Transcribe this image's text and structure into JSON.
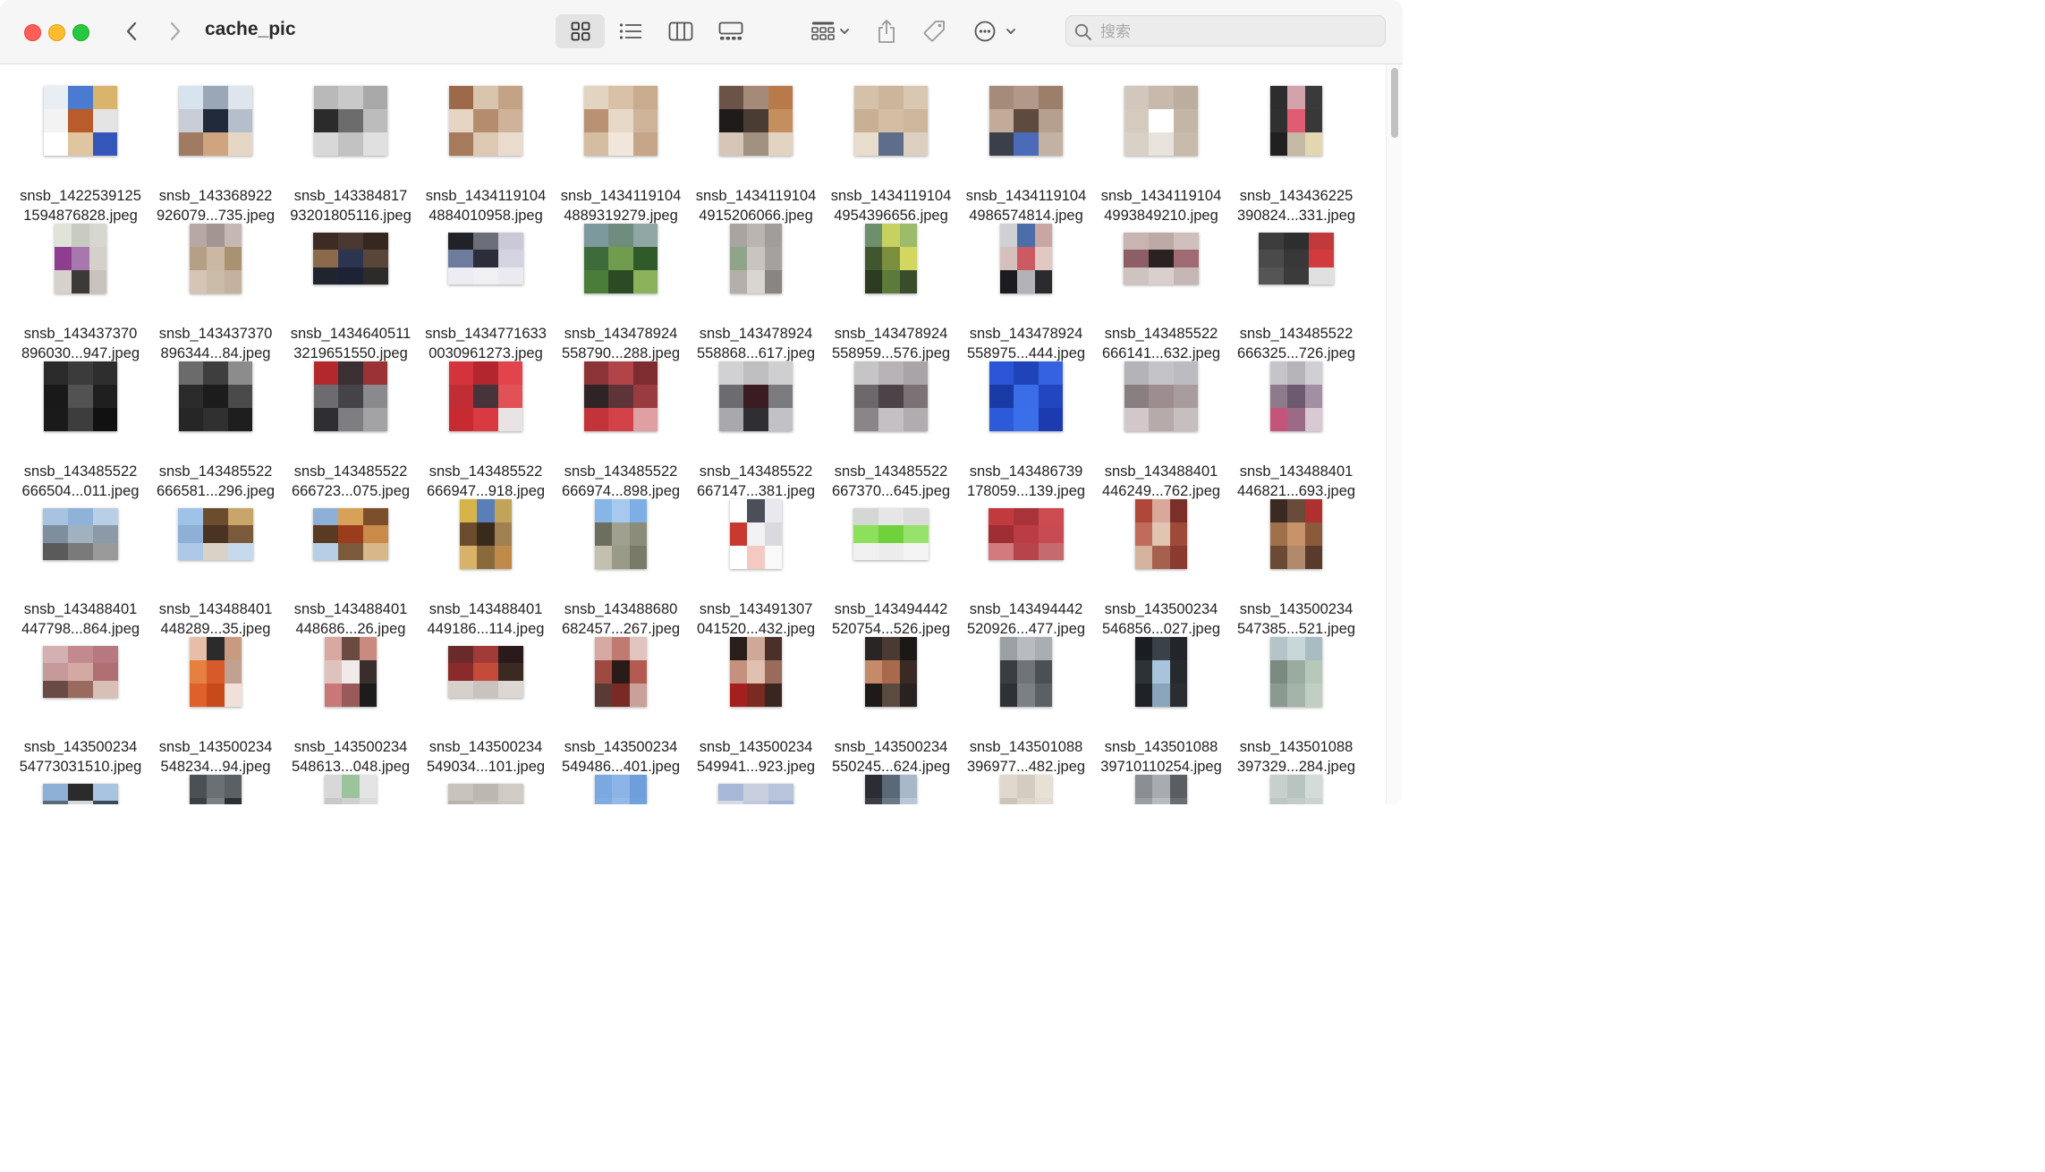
{
  "window": {
    "title": "cache_pic"
  },
  "toolbar": {
    "view_icons": "icon-view-grid-icon",
    "view_list": "list-view-icon",
    "view_columns": "column-view-icon",
    "view_gallery": "gallery-view-icon",
    "group": "group-by-icon",
    "share": "share-icon",
    "tags": "tag-icon",
    "more": "more-actions-icon"
  },
  "search": {
    "placeholder": "搜索",
    "value": ""
  },
  "files": [
    {
      "l1": "snsb_1422539125",
      "l2": "1594876828.jpeg",
      "c": [
        "#e9eef5",
        "#4a7bd0",
        "#d9b46a",
        "#f3f3f3",
        "#b95b2a",
        "#e4e4e4",
        "#ffffff",
        "#e0c6a0",
        "#3456b8"
      ],
      "shape": "sq"
    },
    {
      "l1": "snsb_143368922",
      "l2": "926079...735.jpeg",
      "c": [
        "#d7e3ef",
        "#9aa7b6",
        "#dfe5ec",
        "#c7ccd6",
        "#202a3b",
        "#b5bfcb",
        "#a07b62",
        "#d0a47f",
        "#e6d7c5"
      ],
      "shape": "sq"
    },
    {
      "l1": "snsb_143384817",
      "l2": "93201805116.jpeg",
      "c": [
        "#b9b9b9",
        "#c9c9c9",
        "#a9a9a9",
        "#2b2b2b",
        "#6c6c6c",
        "#bcbcbc",
        "#d8d8d8",
        "#c2c2c2",
        "#e0e0e0"
      ],
      "shape": "sq"
    },
    {
      "l1": "snsb_1434119104",
      "l2": "4884010958.jpeg",
      "c": [
        "#9c6a4b",
        "#d9c4ad",
        "#c4a285",
        "#e5d5c2",
        "#b58d6d",
        "#ceb39a",
        "#a57b5c",
        "#dcc8b3",
        "#e9dccd"
      ],
      "shape": "sq"
    },
    {
      "l1": "snsb_1434119104",
      "l2": "4889319279.jpeg",
      "c": [
        "#e3d4c1",
        "#d8c1a6",
        "#c9ab8e",
        "#b89273",
        "#e7d8c7",
        "#cfb49a",
        "#d5bda1",
        "#f0e6da",
        "#c6a688"
      ],
      "shape": "sq"
    },
    {
      "l1": "snsb_1434119104",
      "l2": "4915206066.jpeg",
      "c": [
        "#6b5447",
        "#a58a79",
        "#b97a4a",
        "#1f1b1a",
        "#4a3b33",
        "#c58e5f",
        "#d7c5b7",
        "#a19181",
        "#e2d3c2"
      ],
      "shape": "sq"
    },
    {
      "l1": "snsb_1434119104",
      "l2": "4954396656.jpeg",
      "c": [
        "#d4c1a9",
        "#ccb59b",
        "#d9c7b1",
        "#c9b094",
        "#d3bea4",
        "#cdb69c",
        "#e8dccd",
        "#5d6d8a",
        "#ddd0c0"
      ],
      "shape": "sq"
    },
    {
      "l1": "snsb_1434119104",
      "l2": "4986574814.jpeg",
      "c": [
        "#a58b79",
        "#b19888",
        "#9c7f6b",
        "#c2ab99",
        "#5e4a3e",
        "#b5a090",
        "#3b3f4c",
        "#4b6ab7",
        "#c3b2a3"
      ],
      "shape": "sq"
    },
    {
      "l1": "snsb_1434119104",
      "l2": "4993849210.jpeg",
      "c": [
        "#d2c7bd",
        "#c7baac",
        "#bcae9f",
        "#d4cabe",
        "#ffffff",
        "#c4b6a6",
        "#d9d0c6",
        "#e8e3dc",
        "#c9bbab"
      ],
      "shape": "sq"
    },
    {
      "l1": "snsb_143436225",
      "l2": "390824...331.jpeg",
      "c": [
        "#2d2d2d",
        "#d3a3ab",
        "#3a3a3a",
        "#303030",
        "#e05c72",
        "#383838",
        "#202020",
        "#c5b9a4",
        "#e2d7b0"
      ],
      "shape": "tall"
    },
    {
      "l1": "snsb_143437370",
      "l2": "896030...947.jpeg",
      "c": [
        "#dfe3d8",
        "#c7cbc1",
        "#d7d6cf",
        "#8d3e8f",
        "#a778ad",
        "#d5d1ca",
        "#d6d2cb",
        "#3b3a38",
        "#c7c2bb"
      ],
      "shape": "tall"
    },
    {
      "l1": "snsb_143437370",
      "l2": "896344...84.jpeg",
      "c": [
        "#b8a8a4",
        "#a39592",
        "#c5b7b2",
        "#b59f86",
        "#ccb8a2",
        "#a8926f",
        "#d6c4b4",
        "#cbbba9",
        "#c4b19e"
      ],
      "shape": "tall"
    },
    {
      "l1": "snsb_1434640511",
      "l2": "3219651550.jpeg",
      "c": [
        "#3e2c24",
        "#4a3830",
        "#352720",
        "#8a6a4a",
        "#2d3450",
        "#5a4638",
        "#20242e",
        "#1e2235",
        "#2e2a28"
      ],
      "shape": "wide"
    },
    {
      "l1": "snsb_1434771633",
      "l2": "0030961273.jpeg",
      "c": [
        "#202228",
        "#6a6f7a",
        "#c9c9d8",
        "#6f7b9c",
        "#2b2e3a",
        "#d4d4e0",
        "#ececf2",
        "#f0f0f4",
        "#eaeaf0"
      ],
      "shape": "wide"
    },
    {
      "l1": "snsb_143478924",
      "l2": "558790...288.jpeg",
      "c": [
        "#7c9a9d",
        "#6f8d7e",
        "#8fa6a4",
        "#3e6b3a",
        "#6f9c4d",
        "#2f5a2a",
        "#4b7d3a",
        "#2c4a24",
        "#8cb25c"
      ],
      "shape": "sq"
    },
    {
      "l1": "snsb_143478924",
      "l2": "558868...617.jpeg",
      "c": [
        "#a9a4a0",
        "#bab5b1",
        "#a29d98",
        "#8ea58a",
        "#c9c4bf",
        "#a6a19c",
        "#b4afa9",
        "#d9d5d1",
        "#8a8581"
      ],
      "shape": "tall"
    },
    {
      "l1": "snsb_143478924",
      "l2": "558959...576.jpeg",
      "c": [
        "#6e8f6b",
        "#c6d160",
        "#9dbb6a",
        "#40562e",
        "#7c8f3f",
        "#d3d65f",
        "#2c3a22",
        "#5c7a3a",
        "#3a4d2a"
      ],
      "shape": "tall"
    },
    {
      "l1": "snsb_143478924",
      "l2": "558975...444.jpeg",
      "c": [
        "#cfcfd6",
        "#4c6ea8",
        "#c9a6a2",
        "#d6c0bd",
        "#cc5a62",
        "#e1c8c3",
        "#1c1c20",
        "#b2b2b8",
        "#2a2a2e"
      ],
      "shape": "tall"
    },
    {
      "l1": "snsb_143485522",
      "l2": "666141...632.jpeg",
      "c": [
        "#c8b4b0",
        "#bda9a6",
        "#d0c0bd",
        "#8e5e66",
        "#2a2123",
        "#a06a72",
        "#cfc3c0",
        "#d9d0cd",
        "#c5b7b4"
      ],
      "shape": "wide"
    },
    {
      "l1": "snsb_143485522",
      "l2": "666325...726.jpeg",
      "c": [
        "#3c3c3c",
        "#2e2e2e",
        "#c0393b",
        "#4a4a4a",
        "#383838",
        "#d23b3d",
        "#555555",
        "#3b3b3b",
        "#e0e0e0"
      ],
      "shape": "wide"
    },
    {
      "l1": "snsb_143485522",
      "l2": "666504...011.jpeg",
      "c": [
        "#2a2a2a",
        "#3b3b3b",
        "#2e2e2e",
        "#191919",
        "#525252",
        "#1f1f1f",
        "#1a1a1a",
        "#3d3d3d",
        "#111111"
      ],
      "shape": "sq"
    },
    {
      "l1": "snsb_143485522",
      "l2": "666581...296.jpeg",
      "c": [
        "#6b6b6b",
        "#3e3e3e",
        "#8c8c8c",
        "#2b2b2b",
        "#1c1c1c",
        "#4a4a4a",
        "#262626",
        "#303030",
        "#1e1e1e"
      ],
      "shape": "sq"
    },
    {
      "l1": "snsb_143485522",
      "l2": "666723...075.jpeg",
      "c": [
        "#b2282d",
        "#3b2f33",
        "#9b3236",
        "#6c6c70",
        "#444448",
        "#8a8a8e",
        "#2f2f33",
        "#7e7e82",
        "#a3a3a6"
      ],
      "shape": "sq"
    },
    {
      "l1": "snsb_143485522",
      "l2": "666947...918.jpeg",
      "c": [
        "#d5333b",
        "#b4262d",
        "#e2444b",
        "#c12d34",
        "#46343a",
        "#e15257",
        "#c82a31",
        "#d93a41",
        "#e9e4e4"
      ],
      "shape": "sq"
    },
    {
      "l1": "snsb_143485522",
      "l2": "666974...898.jpeg",
      "c": [
        "#8c3337",
        "#b04449",
        "#7e2c30",
        "#2e2325",
        "#5f3438",
        "#9a3b3f",
        "#c2333a",
        "#d24248",
        "#e0a0a3"
      ],
      "shape": "sq"
    },
    {
      "l1": "snsb_143485522",
      "l2": "667147...381.jpeg",
      "c": [
        "#d1d1d4",
        "#bfbfc2",
        "#cfcfd2",
        "#6b6b70",
        "#3b1c22",
        "#7a7a7f",
        "#a9a9ad",
        "#2f2f33",
        "#c2c2c6"
      ],
      "shape": "sq"
    },
    {
      "l1": "snsb_143485522",
      "l2": "667370...645.jpeg",
      "c": [
        "#c7c4c7",
        "#b7b3b6",
        "#a8a4a7",
        "#6d686b",
        "#4d4247",
        "#7a7275",
        "#8a8588",
        "#c4c0c3",
        "#b0acaf"
      ],
      "shape": "sq"
    },
    {
      "l1": "snsb_143486739",
      "l2": "178059...139.jpeg",
      "c": [
        "#2a55d6",
        "#1f43b8",
        "#3562e0",
        "#1a3aa6",
        "#3a6de8",
        "#2146bf",
        "#2d5ad8",
        "#3b6ee9",
        "#1c3bb0"
      ],
      "shape": "sq"
    },
    {
      "l1": "snsb_143488401",
      "l2": "446249...762.jpeg",
      "c": [
        "#b3b3b8",
        "#c4c4c8",
        "#bcbcc0",
        "#8a7f80",
        "#9e8d8f",
        "#a89c9d",
        "#d2c8c9",
        "#b6aaab",
        "#c7bfbf"
      ],
      "shape": "sq"
    },
    {
      "l1": "snsb_143488401",
      "l2": "446821...693.jpeg",
      "c": [
        "#c6c4c9",
        "#b7b3b9",
        "#d1cfd4",
        "#8e7a8c",
        "#6e5a70",
        "#a38fa3",
        "#c4557a",
        "#9a6a86",
        "#d8c9d3"
      ],
      "shape": "tall"
    },
    {
      "l1": "snsb_143488401",
      "l2": "447798...864.jpeg",
      "c": [
        "#a7c3e0",
        "#8fb3d8",
        "#b9cfe6",
        "#7d8f9e",
        "#a1b1bf",
        "#8b9aa6",
        "#5a5a5a",
        "#7a7a7a",
        "#9a9a9a"
      ],
      "shape": "wide"
    },
    {
      "l1": "snsb_143488401",
      "l2": "448289...35.jpeg",
      "c": [
        "#9fc2e8",
        "#6b4d2e",
        "#c9a56a",
        "#8fb0d6",
        "#4a3322",
        "#7a5a3a",
        "#aec9e8",
        "#d9d2c6",
        "#c7d9ec"
      ],
      "shape": "wide"
    },
    {
      "l1": "snsb_143488401",
      "l2": "448686...26.jpeg",
      "c": [
        "#8fb0d6",
        "#d8a15a",
        "#7b4e2c",
        "#5a3a22",
        "#9b3d1c",
        "#c98a4a",
        "#b7cfe6",
        "#7a5a3a",
        "#d8b88a"
      ],
      "shape": "wide"
    },
    {
      "l1": "snsb_143488401",
      "l2": "449186...114.jpeg",
      "c": [
        "#d7b44a",
        "#5a7fb6",
        "#c2a35a",
        "#6b4d2e",
        "#3a2a1c",
        "#a08050",
        "#d9b26a",
        "#8a6a3a",
        "#c08a4a"
      ],
      "shape": "tall"
    },
    {
      "l1": "snsb_143488680",
      "l2": "682457...267.jpeg",
      "c": [
        "#86b6e8",
        "#a7c9ed",
        "#7daee5",
        "#6e6e5e",
        "#a0a090",
        "#8c8c7a",
        "#c4c0b0",
        "#9a9a88",
        "#7a7a68"
      ],
      "shape": "tall"
    },
    {
      "l1": "snsb_143491307",
      "l2": "041520...432.jpeg",
      "c": [
        "#ffffff",
        "#4a4f5a",
        "#e8e8ee",
        "#c93a2e",
        "#f2f2f4",
        "#dadade",
        "#ffffff",
        "#f4c9c2",
        "#f9f9f9"
      ],
      "shape": "tall"
    },
    {
      "l1": "snsb_143494442",
      "l2": "520754...526.jpeg",
      "c": [
        "#d4d8d4",
        "#e6e6e6",
        "#dcdcdc",
        "#8ce05a",
        "#6fd23a",
        "#95e36a",
        "#f0f0f0",
        "#ececec",
        "#f4f4f4"
      ],
      "shape": "wide"
    },
    {
      "l1": "snsb_143494442",
      "l2": "520926...477.jpeg",
      "c": [
        "#c23a3e",
        "#a8343a",
        "#cc4a50",
        "#9e2e34",
        "#bb3c44",
        "#c84a52",
        "#d27a7e",
        "#b5454b",
        "#c56a6e"
      ],
      "shape": "wide"
    },
    {
      "l1": "snsb_143500234",
      "l2": "546856...027.jpeg",
      "c": [
        "#b0483a",
        "#d9a89a",
        "#7a2f28",
        "#c06c5a",
        "#e2c4b2",
        "#9e4a3a",
        "#d4b29e",
        "#a6604e",
        "#8a3a30"
      ],
      "shape": "tall"
    },
    {
      "l1": "snsb_143500234",
      "l2": "547385...521.jpeg",
      "c": [
        "#3a2a22",
        "#6a4a3a",
        "#b03030",
        "#a0704a",
        "#c8936a",
        "#8a5a3a",
        "#6a4a34",
        "#b08a6a",
        "#5a3a2a"
      ],
      "shape": "tall"
    },
    {
      "l1": "snsb_143500234",
      "l2": "54773031510.jpeg",
      "c": [
        "#d4b0b3",
        "#c28a8e",
        "#b87880",
        "#c69a9a",
        "#d3a9a4",
        "#b06f72",
        "#6a4a44",
        "#9a6a5e",
        "#d8c0b6"
      ],
      "shape": "wide"
    },
    {
      "l1": "snsb_143500234",
      "l2": "548234...94.jpeg",
      "c": [
        "#e7bfa8",
        "#2a2a2a",
        "#c89a80",
        "#e58040",
        "#d85a2a",
        "#c0a090",
        "#e0602a",
        "#c84a1a",
        "#f0e0d8"
      ],
      "shape": "tall"
    },
    {
      "l1": "snsb_143500234",
      "l2": "548613...048.jpeg",
      "c": [
        "#d8a9a0",
        "#6b4a42",
        "#c98b80",
        "#e0c2bc",
        "#f0eaea",
        "#3a2e2c",
        "#c9787a",
        "#9b5a5a",
        "#1c1c1c"
      ],
      "shape": "tall"
    },
    {
      "l1": "snsb_143500234",
      "l2": "549034...101.jpeg",
      "c": [
        "#6b2a2a",
        "#a33a3a",
        "#2a1a1a",
        "#8a2a2a",
        "#c44a3a",
        "#3a2a22",
        "#d6d0cc",
        "#c9c3bf",
        "#ddd7d3"
      ],
      "shape": "wide"
    },
    {
      "l1": "snsb_143500234",
      "l2": "549486...401.jpeg",
      "c": [
        "#d6a9a2",
        "#c07a72",
        "#e2c4bf",
        "#9e4a40",
        "#2a1a18",
        "#b55a50",
        "#5a3a34",
        "#7a2a24",
        "#c9a09a"
      ],
      "shape": "tall"
    },
    {
      "l1": "snsb_143500234",
      "l2": "549941...923.jpeg",
      "c": [
        "#2a1e1a",
        "#d0a898",
        "#4a3028",
        "#c5907e",
        "#e0c0b0",
        "#9a6a5a",
        "#a4201e",
        "#7a2a20",
        "#3a2620"
      ],
      "shape": "tall"
    },
    {
      "l1": "snsb_143500234",
      "l2": "550245...624.jpeg",
      "c": [
        "#2a2422",
        "#4a3a32",
        "#1c1816",
        "#c48a6a",
        "#a86a4a",
        "#3a2a24",
        "#1e1a18",
        "#5a4a40",
        "#2a2220"
      ],
      "shape": "tall"
    },
    {
      "l1": "snsb_143501088",
      "l2": "396977...482.jpeg",
      "c": [
        "#9aa0a4",
        "#b8bcc0",
        "#a8aeb2",
        "#3a3e42",
        "#6e7478",
        "#4a5054",
        "#2e3236",
        "#7a8084",
        "#5a6064"
      ],
      "shape": "tall"
    },
    {
      "l1": "snsb_143501088",
      "l2": "39710110254.jpeg",
      "c": [
        "#1a1e22",
        "#3a4248",
        "#22262a",
        "#2c3238",
        "#a8c4dc",
        "#262a2e",
        "#1e2226",
        "#8aa4bc",
        "#2a2e32"
      ],
      "shape": "tall"
    },
    {
      "l1": "snsb_143501088",
      "l2": "397329...284.jpeg",
      "c": [
        "#b4c4c8",
        "#c8d8d8",
        "#a8bcc4",
        "#7a8a80",
        "#9aaca0",
        "#b8c8b8",
        "#8a9a90",
        "#a4b4a8",
        "#c0cec4"
      ],
      "shape": "tall"
    },
    {
      "l1": "",
      "l2": "",
      "c": [
        "#8fb0d6",
        "#2a2a2a",
        "#a8c4e0",
        "#5a6a7a",
        "#d4d8dc",
        "#3a4a5a",
        "#6a7a8a",
        "#a0b0c0",
        "#c0ccd8"
      ],
      "shape": "wide"
    },
    {
      "l1": "",
      "l2": "",
      "c": [
        "#4a5054",
        "#6a7074",
        "#5a6064",
        "#3a4044",
        "#7a8084",
        "#2a3034",
        "#5a6064",
        "#8a9094",
        "#4a5054"
      ],
      "shape": "tall"
    },
    {
      "l1": "",
      "l2": "",
      "c": [
        "#d8d8d8",
        "#9cc49c",
        "#e4e4e4",
        "#c8c8c8",
        "#d0d0d0",
        "#dcdcdc",
        "#e8e8e8",
        "#d4d4d4",
        "#e0e0e0"
      ],
      "shape": "tall"
    },
    {
      "l1": "",
      "l2": "",
      "c": [
        "#c8c4bc",
        "#bcb8b0",
        "#d0ccc4",
        "#b8b4ac",
        "#c4c0b8",
        "#ccc8c0",
        "#bcb8b0",
        "#c8c4bc",
        "#d0ccc4"
      ],
      "shape": "wide"
    },
    {
      "l1": "",
      "l2": "",
      "c": [
        "#7aa8e0",
        "#8cb4e6",
        "#6e9edc",
        "#80acE2",
        "#94bae8",
        "#72a2de",
        "#86b0e4",
        "#98bcea",
        "#7aa6e0"
      ],
      "shape": "tall"
    },
    {
      "l1": "",
      "l2": "",
      "c": [
        "#a8b8d8",
        "#c8d0e0",
        "#b8c4dc",
        "#d4dae6",
        "#c0cadc",
        "#a4b4d4",
        "#d8dee8",
        "#b4c0d8",
        "#c4cede"
      ],
      "shape": "wide"
    },
    {
      "l1": "",
      "l2": "",
      "c": [
        "#2a2e34",
        "#5a6878",
        "#a8b8c8",
        "#3a3e44",
        "#6a7888",
        "#b8c8d8",
        "#4a4e54",
        "#7a8898",
        "#c8d8e8"
      ],
      "shape": "tall"
    },
    {
      "l1": "",
      "l2": "",
      "c": [
        "#e0d8cc",
        "#d4ccc0",
        "#e8e0d4",
        "#ccc4b8",
        "#dcd4c8",
        "#e4dcd0",
        "#d0c8bc",
        "#d8d0c4",
        "#e0d8cc"
      ],
      "shape": "tall"
    },
    {
      "l1": "",
      "l2": "",
      "c": [
        "#8a8e92",
        "#a8acb0",
        "#5a5e62",
        "#9a9ea2",
        "#b8bcc0",
        "#6a6e72",
        "#aaaeb2",
        "#c8ccd0",
        "#7a7e82"
      ],
      "shape": "tall"
    },
    {
      "l1": "",
      "l2": "",
      "c": [
        "#c8d0cc",
        "#b8c4c0",
        "#d4dcd8",
        "#bcc8c4",
        "#c4ccc8",
        "#ccd4d0",
        "#b4c0bc",
        "#c0c8c4",
        "#d0d8d4"
      ],
      "shape": "tall"
    }
  ]
}
